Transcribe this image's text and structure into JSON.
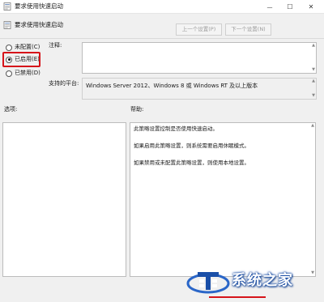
{
  "window": {
    "title": "要求使用快速启动",
    "minimize_glyph": "—",
    "maximize_glyph": "☐",
    "close_glyph": "✕"
  },
  "header": {
    "setting_name": "要求使用快速启动",
    "prev_button": "上一个设置(P)",
    "next_button": "下一个设置(N)"
  },
  "options": {
    "radios": [
      {
        "label": "未配置(C)",
        "checked": false
      },
      {
        "label": "已启用(E)",
        "checked": true
      },
      {
        "label": "已禁用(D)",
        "checked": false
      }
    ],
    "highlight_color": "#d6141a"
  },
  "comment": {
    "label": "注释:",
    "value": ""
  },
  "platform": {
    "label": "支持的平台:",
    "value": "Windows Server 2012、Windows 8 或 Windows RT 及以上版本"
  },
  "panels": {
    "options_label": "选项:",
    "help_label": "帮助:"
  },
  "help": {
    "lines": [
      "此策略设置控制是否使用快速启动。",
      "如果启用此策略设置，则系统需要启用休眠模式。",
      "如果禁用或未配置此策略设置，则使用本地设置。"
    ]
  },
  "watermark": {
    "text": "系统之家",
    "color": "#1a4fa8"
  }
}
